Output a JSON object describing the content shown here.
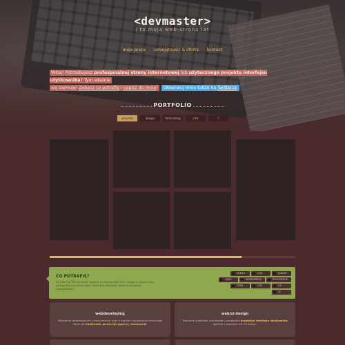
{
  "header": {
    "logo": "<devmaster>",
    "tagline": "i to moja web-strona lat",
    "nav": [
      "moje prace",
      "umiejętności & oferta",
      "kontakt"
    ]
  },
  "intro": {
    "greeting": "Witaj! Potrzebujesz",
    "bold1": "profesjonalnej strony internetowej",
    "mid": "lub",
    "bold2": "użytecznego projektu interfejsu użytkownika",
    "end": "? Tym właśnie",
    "line2_start": "się zajmuję!",
    "link1": "Zobacz co potrafię",
    "and": "i",
    "link2": "napisz do mnie",
    "excl": "!",
    "twitter_text": "Obserwuj mnie także na",
    "twitter_link": "Twitterze"
  },
  "portfolio": {
    "title": "PORTFOLIO",
    "filters": [
      "wszystko",
      "design",
      "htmlcoding",
      "cms",
      "?"
    ],
    "active_filter": "wszystko",
    "progress_percent": 78
  },
  "skills": {
    "title": "CO POTRAFIĘ?",
    "description": "Od wielu lat tworzę strony zgodnie ze standardami W3C, dbając o użyteczność, dostępność oraz semantykę. Projektuję interfejsy, które są przyjazne użytkownikom.",
    "chips": [
      "HTML5",
      "CSS",
      "JQUERY",
      "SASS",
      "WORDPRESS",
      "PHOTOSHOP",
      "HTML",
      "CSS",
      "UX",
      "UI"
    ]
  },
  "cards": [
    {
      "title": "webdeveloping",
      "desc_a": "Wdrażanie responsywnych, nowoczesnych stron z użyciem najnowszych technologii takich jak",
      "desc_bold": "html5/css3, JavaScript (jquery), frameworki",
      "desc_b": "."
    },
    {
      "title": "web/ui design",
      "desc_a": "Tworzenie projektów, prototypów i przeglądów",
      "desc_bold": "projektów interfejsu użytkownika",
      "desc_b": "zgodnie z zasadami UX i UI design."
    }
  ],
  "colors": {
    "background": "#4a2a2c",
    "accent_gold": "#e3b65a",
    "highlight_red": "#b9685f",
    "twitter_blue": "#4da6e0",
    "skills_green": "#8fa84f",
    "tile_dark": "#2e2223"
  }
}
